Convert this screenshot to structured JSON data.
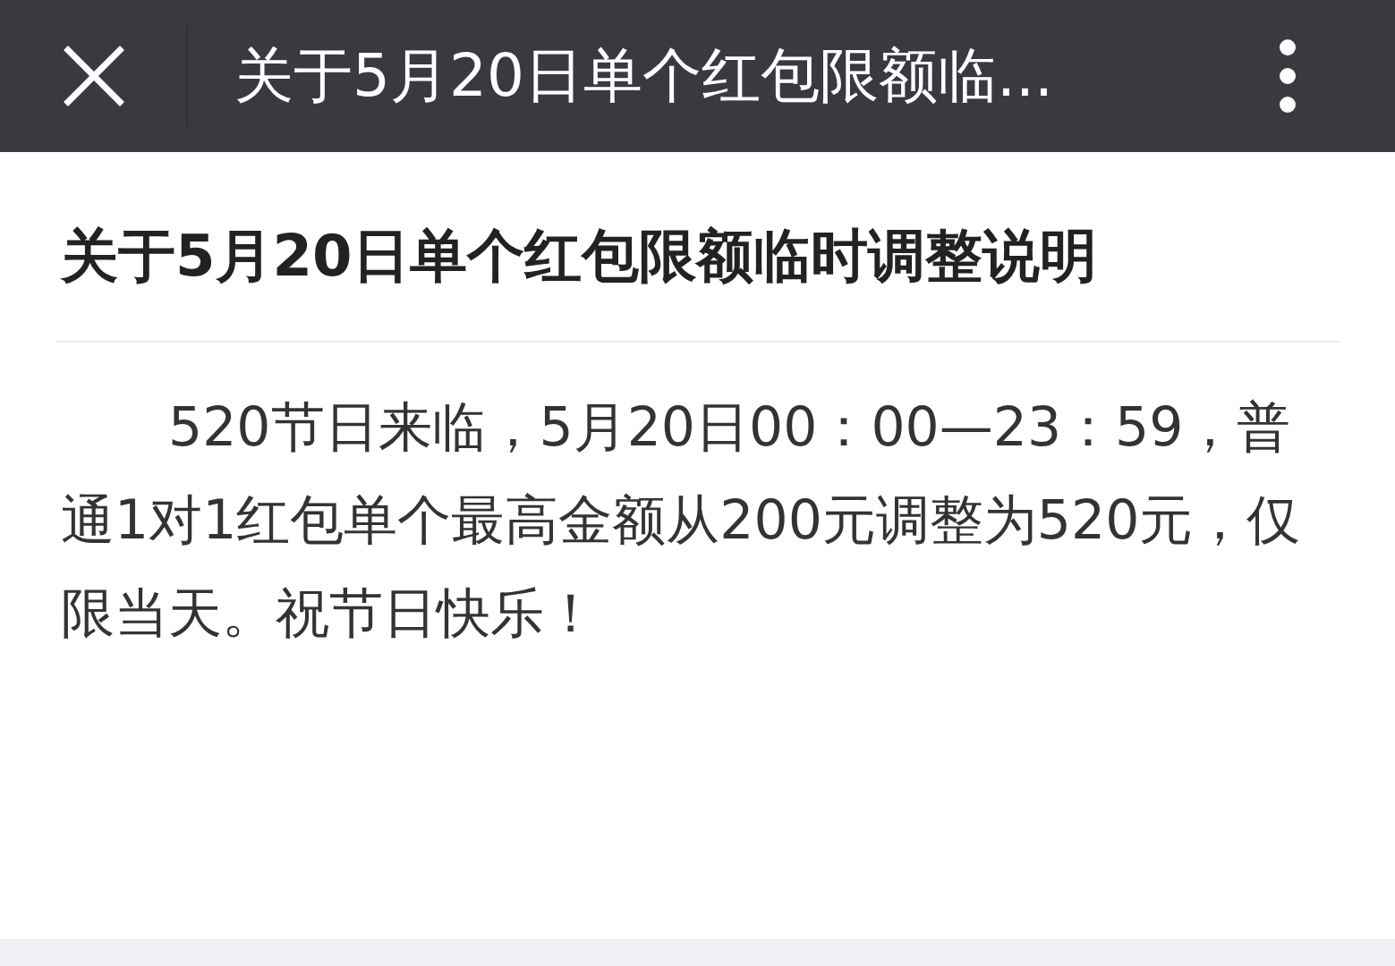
{
  "top_bar": {
    "title": "关于5月20日单个红包限额临..."
  },
  "article": {
    "title": "关于5月20日单个红包限额临时调整说明",
    "body": "520节日来临，5月20日00：00—23：59，普通1对1红包单个最高金额从200元调整为520元，仅限当天。祝节日快乐！"
  }
}
